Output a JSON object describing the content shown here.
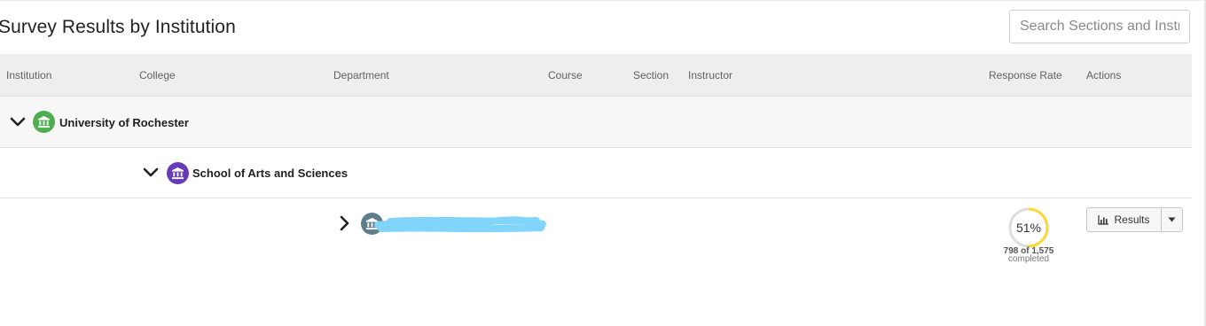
{
  "page": {
    "title": "Survey Results by Institution"
  },
  "search": {
    "placeholder": "Search Sections and Instructors"
  },
  "columns": [
    "Institution",
    "College",
    "Department",
    "Course",
    "Section",
    "Instructor",
    "Response Rate",
    "Actions"
  ],
  "rows": {
    "institution": {
      "label": "University of Rochester",
      "expanded": true,
      "icon": "institution-icon",
      "color": "#4caf50"
    },
    "college": {
      "label": "School of Arts and Sciences",
      "expanded": true,
      "icon": "institution-icon",
      "color": "#673ab7"
    },
    "department": {
      "expanded": false,
      "icon": "institution-icon",
      "color": "#607d8b",
      "response_rate": {
        "percent_label": "51%",
        "percent": 0.51,
        "count_label": "798 of 1,575",
        "sub_label": "completed",
        "ring_color": "#fdd835"
      },
      "actions": {
        "results_label": "Results"
      }
    }
  },
  "colors": {
    "header_bg": "#eeeeee",
    "institution_row_bg": "#f7f7f7",
    "redaction": "#81d4fa"
  }
}
